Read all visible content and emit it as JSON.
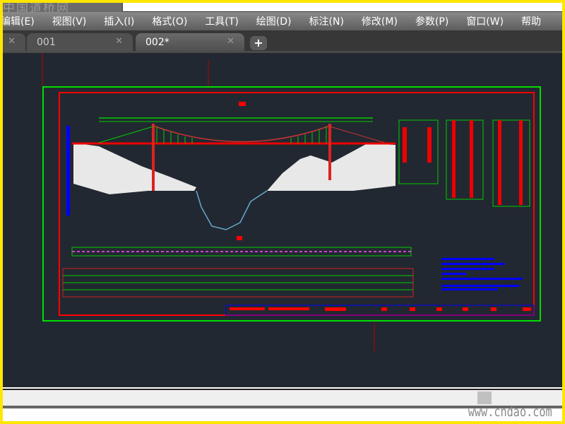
{
  "titlebar": {
    "logo_text": "中国道桥网"
  },
  "menu": [
    "编辑(E)",
    "视图(V)",
    "插入(I)",
    "格式(O)",
    "工具(T)",
    "绘图(D)",
    "标注(N)",
    "修改(M)",
    "参数(P)",
    "窗口(W)",
    "帮助"
  ],
  "tabs": [
    {
      "label": "001",
      "active": false
    },
    {
      "label": "002*",
      "active": true
    }
  ],
  "add_tab": "+",
  "close_glyph": "✕",
  "watermark": "www.cndao.com",
  "colors": {
    "canvas": "#222831",
    "frame_green": "#00dd00",
    "frame_red": "#ff0000",
    "dim_blue": "#0000ff"
  }
}
